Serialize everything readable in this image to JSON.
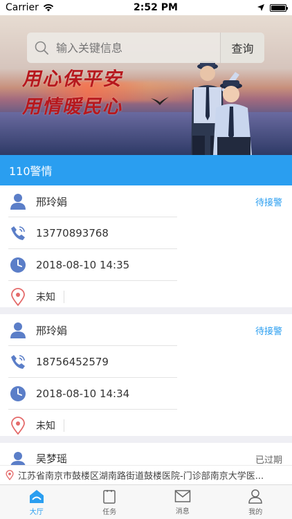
{
  "status_bar": {
    "carrier": "Carrier",
    "time": "2:52 PM"
  },
  "banner": {
    "slogan_line1": "用心保平安",
    "slogan_line2": "用情暖民心"
  },
  "search": {
    "placeholder": "输入关键信息",
    "button_label": "查询"
  },
  "section": {
    "title": "110警情"
  },
  "alerts": [
    {
      "name": "邢玲娟",
      "status": "待接警",
      "phone": "13770893768",
      "time": "2018-08-10 14:35",
      "location": "未知"
    },
    {
      "name": "邢玲娟",
      "status": "待接警",
      "phone": "18756452579",
      "time": "2018-08-10 14:34",
      "location": "未知"
    },
    {
      "name": "吴梦瑶",
      "status": "已过期"
    }
  ],
  "address": {
    "text": "江苏省南京市鼓楼区湖南路街道鼓楼医院-门诊部南京大学医..."
  },
  "tabs": [
    {
      "label": "大厅",
      "icon": "home-icon"
    },
    {
      "label": "任务",
      "icon": "clipboard-icon"
    },
    {
      "label": "消息",
      "icon": "mail-icon"
    },
    {
      "label": "我的",
      "icon": "person-icon"
    }
  ],
  "colors": {
    "accent": "#2a9ef0",
    "expired": "#666666",
    "icon_blue": "#5b7ec8",
    "location_red": "#e46a6a"
  }
}
